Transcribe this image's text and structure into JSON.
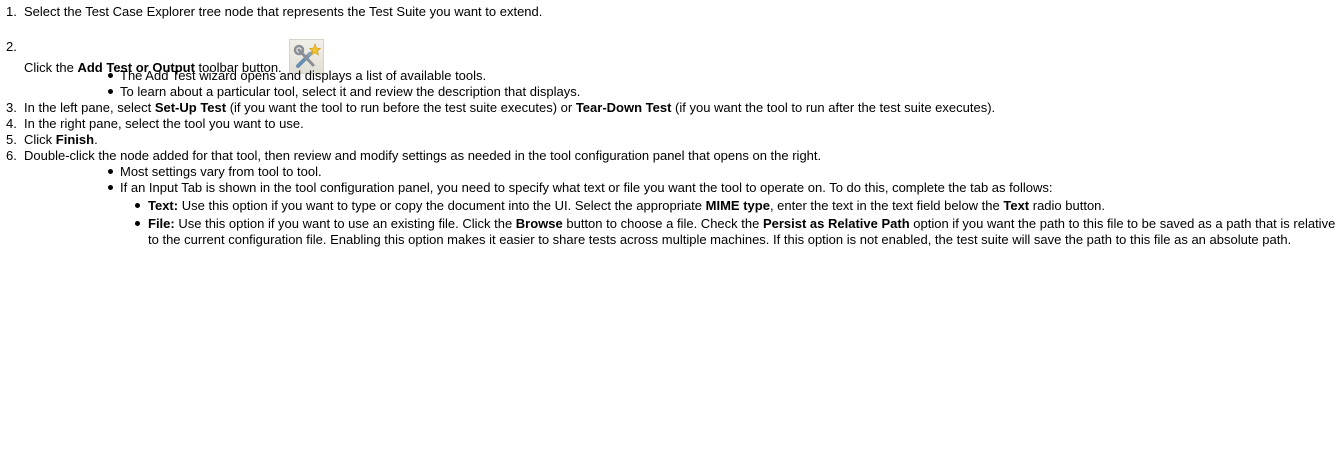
{
  "steps": [
    {
      "num": "1.",
      "text": "Select the Test Case Explorer tree node that represents the Test Suite you want to extend."
    },
    {
      "num": "2.",
      "pre": "Click the ",
      "bold": "Add Test or Output",
      "post": " toolbar button.",
      "icon": "add-test-tool-icon",
      "bullets": [
        "The Add Test wizard opens and displays a list of available tools.",
        "To learn about a particular tool, select it and review the description that displays."
      ]
    },
    {
      "num": "3.",
      "pre": "In the left pane, select ",
      "bold1": "Set-Up Test",
      "mid": " (if you want the tool to run before the test suite executes) or ",
      "bold2": "Tear-Down Test",
      "post": " (if you want the tool to run after the test suite executes)."
    },
    {
      "num": "4.",
      "text": "In the right pane, select the tool you want to use."
    },
    {
      "num": "5.",
      "pre": "Click ",
      "bold": "Finish",
      "post": "."
    },
    {
      "num": "6.",
      "text": "Double-click the node added for that tool, then review and modify settings as needed in the tool configuration panel that opens on the right.",
      "bullets": [
        "Most settings vary from tool to tool.",
        "If an Input Tab is shown in the tool configuration panel, you need to specify what  text or file  you want the tool to operate on. To do this, complete the tab as follows:"
      ],
      "sub": [
        {
          "bold": "Text:",
          "t1": " Use this option if you want to type or copy the document into the UI. Select the appropriate ",
          "b2": "MIME type",
          "t2": ", enter the text in the text field below the ",
          "b3": "Text",
          "t3": " radio button."
        },
        {
          "bold": "File:",
          "t1": " Use this option if you want to use an existing file. Click the ",
          "b2": "Browse",
          "t2": " button to choose a file. Check the ",
          "b3": "Persist as Relative Path",
          "t3": " option if you want the path to this file to be saved as a path that is relative to the current configuration file. Enabling this option makes it easier to share tests across multiple machines. If this option is not enabled, the test suite will save the path to this file as an absolute path."
        }
      ]
    }
  ]
}
